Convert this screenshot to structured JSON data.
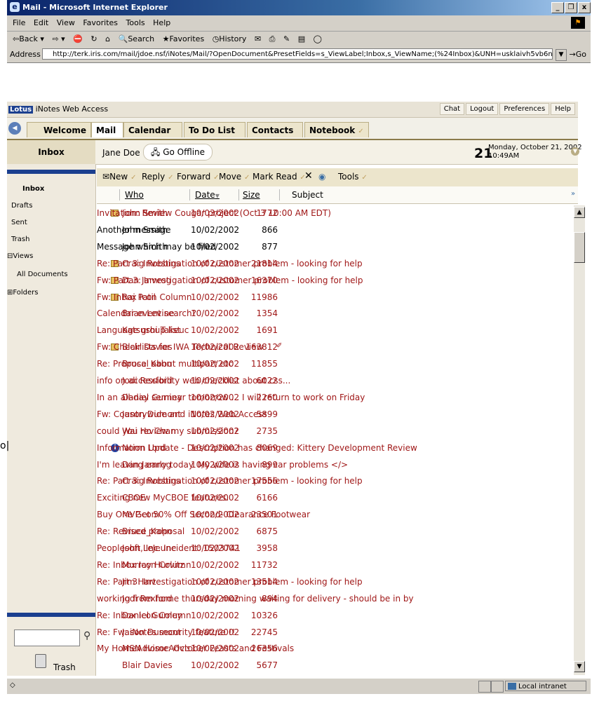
{
  "window": {
    "title": "Mail - Microsoft Internet Explorer",
    "controls": [
      "_",
      "❒",
      "x"
    ]
  },
  "menu": [
    "File",
    "Edit",
    "View",
    "Favorites",
    "Tools",
    "Help"
  ],
  "toolbar": {
    "back": "⇦Back ▾",
    "forward": "⇨ ▾",
    "search": "Search",
    "favorites": "Favorites",
    "history": "History"
  },
  "address": {
    "label": "Address",
    "url": "http://terk.iris.com/mail/jdoe.nsf/iNotes/Mail/?OpenDocument&PresetFields=s_ViewLabel;Inbox,s_ViewName;(%24Inbox)&UNH=usklaivh5vb6n108m3r7iufdqlk",
    "go": "Go"
  },
  "lotus": {
    "brand_logo": "Lotus",
    "brand_text": "iNotes Web Access",
    "links": [
      "Chat",
      "Logout",
      "Preferences",
      "Help"
    ]
  },
  "tabs": [
    "Welcome",
    "Mail",
    "Calendar",
    "To Do List",
    "Contacts",
    "Notebook"
  ],
  "header": {
    "folder_title": "Inbox",
    "user": "Jane Doe",
    "offline": "Go Offline",
    "day": "21",
    "date_line1": "Monday, October 21, 2002",
    "date_line2": "10:49AM"
  },
  "nav": {
    "items": [
      "Inbox",
      "Drafts",
      "Sent",
      "Trash"
    ],
    "views_label": "Views",
    "all_documents": "All Documents",
    "folders_label": "Folders",
    "trash_bottom": "Trash"
  },
  "actions": [
    "New",
    "Reply",
    "Forward",
    "Move",
    "Mark Read",
    "Tools"
  ],
  "columns": {
    "who": "Who",
    "date": "Date",
    "size": "Size",
    "subject": "Subject"
  },
  "messages": [
    {
      "who": "John Smith",
      "date": "10/03/2002",
      "size": "1772",
      "subject": "Invitation: Review Cougar project (Oct 3 10:00 AM EDT)",
      "icon": "calendar",
      "unread": true
    },
    {
      "who": "John Smith",
      "date": "10/02/2002",
      "size": "866",
      "subject": "Another message",
      "icon": "",
      "unread": false
    },
    {
      "who": "John Smith",
      "date": "10/02/2002",
      "size": "877",
      "subject": "Message which may be filed",
      "icon": "",
      "unread": false
    },
    {
      "who": "Craig Robbins",
      "date": "10/02/2002",
      "size": "21814",
      "subject": "Re: Part 3: Investigation of customer problem - looking for help",
      "icon": "envelope",
      "unread": true
    },
    {
      "who": "Dan Jamrog",
      "date": "10/02/2002",
      "size": "16370",
      "subject": "Fw: Part 3: Investigation of customer problem - looking for help",
      "icon": "envelope",
      "unread": true
    },
    {
      "who": "Raj Patil",
      "date": "10/02/2002",
      "size": "11986",
      "subject": "Fw: Inbox Icon Column",
      "icon": "envelope",
      "unread": true
    },
    {
      "who": "Brian Levine",
      "date": "10/02/2002",
      "size": "1354",
      "subject": "Calendar event search?",
      "icon": "",
      "unread": true
    },
    {
      "who": "Katsushi Takeuchi",
      "date": "10/02/2002",
      "size": "1691",
      "subject": "Language group list",
      "icon": "",
      "unread": true
    },
    {
      "who": "Blair Davies",
      "date": "10/02/2002",
      "size": "163812",
      "subject": "Fw: Checklists for IWA Technical Review",
      "icon": "envelope",
      "unread": true,
      "attachment": true
    },
    {
      "who": "Bruce_Kahn",
      "date": "10/02/2002",
      "size": "11855",
      "subject": "Re: Proposal about multipart etc",
      "icon": "",
      "unread": true
    },
    {
      "who": "Jodi Rexford",
      "date": "10/02/2002",
      "size": "6022",
      "subject": "info on accessibility web checklist about css...",
      "icon": "",
      "unread": true
    },
    {
      "who": "Daniel Gurney",
      "date": "10/02/2002",
      "size": "2260",
      "subject": "In an all-day seminar tomorrow ... I will return to work on Friday",
      "icon": "",
      "unread": true
    },
    {
      "who": "Jason Dumont",
      "date": "10/02/2002",
      "size": "5899",
      "subject": "Fw: Countrywide and iNotes Web Access",
      "icon": "",
      "unread": true
    },
    {
      "who": "Wai Ho Chan",
      "date": "10/02/2002",
      "size": "2735",
      "subject": "could you review my submission?",
      "icon": "",
      "unread": true
    },
    {
      "who": "Norm Lord",
      "date": "10/02/2002",
      "size": "8069",
      "subject": "Information Update - Description has changed: Kittery Development Review",
      "icon": "info",
      "unread": true
    },
    {
      "who": "Dan Jamrog",
      "date": "10/02/2002",
      "size": "899",
      "subject": "I'm leaving early today.  My wife is having car problems </>",
      "icon": "",
      "unread": true
    },
    {
      "who": "Craig Robbins",
      "date": "10/02/2002",
      "size": "17556",
      "subject": "Re: Part 3: Investigation of customer problem - looking for help",
      "icon": "",
      "unread": true
    },
    {
      "who": "CBOE",
      "date": "10/02/2002",
      "size": "6166",
      "subject": "Exciting new MyCBOE features.",
      "icon": "",
      "unread": true
    },
    {
      "who": "MVP.com",
      "date": "10/02/2002",
      "size": "23501",
      "subject": "Buy One Get 50% Off Second- Clearance Footwear",
      "icon": "",
      "unread": true
    },
    {
      "who": "Bruce_Kahn",
      "date": "10/02/2002",
      "size": "6875",
      "subject": "Re: Revised proposal",
      "icon": "",
      "unread": true
    },
    {
      "who": "John LeJeune",
      "date": "10/02/2002",
      "size": "3958",
      "subject": "Peoplesoft, Inc.  Incident: 1503741",
      "icon": "",
      "unread": true
    },
    {
      "who": "Murray Hurvitz",
      "date": "10/02/2002",
      "size": "11732",
      "subject": "Re: Inbox Icon Column",
      "icon": "",
      "unread": true
    },
    {
      "who": "Jim Hart",
      "date": "10/02/2002",
      "size": "13514",
      "subject": "Re: Part 3: Investigation of customer problem - looking for help",
      "icon": "",
      "unread": true
    },
    {
      "who": "Jodi Rexford",
      "date": "10/02/2002",
      "size": "894",
      "subject": "working from home thursday morning waiting for delivery - should be in by",
      "icon": "",
      "unread": true
    },
    {
      "who": "Daniel Gurney",
      "date": "10/02/2002",
      "size": "10326",
      "subject": "Re: Inbox Icon Column",
      "icon": "",
      "unread": true
    },
    {
      "who": "Jason Dumont",
      "date": "10/02/2002",
      "size": "22745",
      "subject": "Re: Fw: iNotes security feature !!",
      "icon": "",
      "unread": true
    },
    {
      "who": "MSN HomeAdvisor",
      "date": "10/02/2002",
      "size": "26356",
      "subject": "My HomeAdvisor: October Feasts and Festivals",
      "icon": "",
      "unread": true
    },
    {
      "who": "Blair Davies",
      "date": "10/02/2002",
      "size": "5677",
      "subject": "",
      "icon": "",
      "unread": true
    }
  ],
  "status": {
    "zone": "Local intranet"
  },
  "edge_fragment": "o|",
  "colors": {
    "unread": "#a01818",
    "accent": "#1b3f8f",
    "tab_bg": "#ece5cc"
  }
}
